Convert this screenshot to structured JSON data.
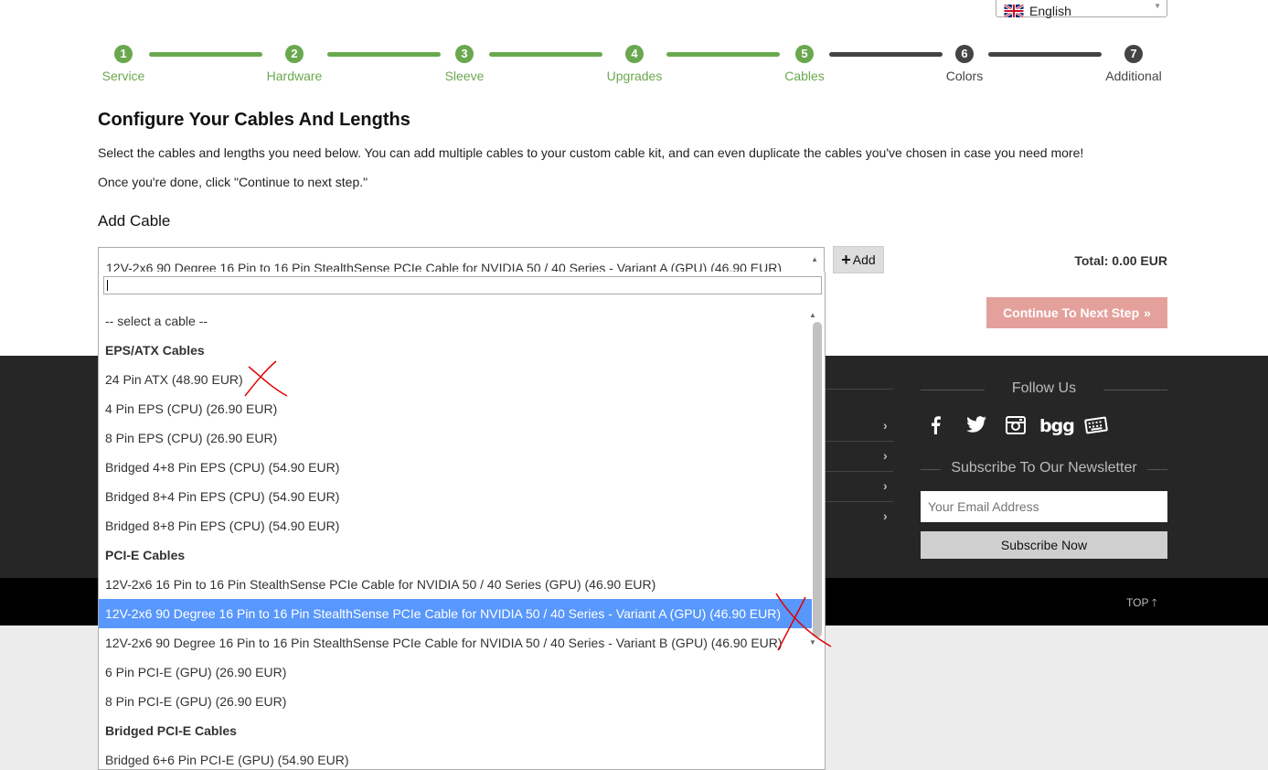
{
  "language": {
    "label": "English"
  },
  "steps": [
    {
      "num": "1",
      "label": "Service",
      "state": "done"
    },
    {
      "num": "2",
      "label": "Hardware",
      "state": "done"
    },
    {
      "num": "3",
      "label": "Sleeve",
      "state": "done"
    },
    {
      "num": "4",
      "label": "Upgrades",
      "state": "done"
    },
    {
      "num": "5",
      "label": "Cables",
      "state": "done"
    },
    {
      "num": "6",
      "label": "Colors",
      "state": "todo"
    },
    {
      "num": "7",
      "label": "Additional",
      "state": "todo"
    }
  ],
  "main": {
    "title": "Configure Your Cables And Lengths",
    "intro": "Select the cables and lengths you need below. You can add multiple cables to your custom cable kit, and can even duplicate the cables you've chosen in case you need more!",
    "instruction": "Once you're done, click \"Continue to next step.\"",
    "add_cable_heading": "Add Cable",
    "selected_cable": "12V-2x6 90 Degree 16 Pin to 16 Pin StealthSense PCIe Cable for NVIDIA 50 / 40 Series - Variant A (GPU) (46.90 EUR)",
    "add_label": "Add",
    "total": "Total: 0.00 EUR",
    "continue_label": "Continue To Next Step"
  },
  "dropdown": {
    "items": [
      {
        "label": "-- select a cable --",
        "kind": "option"
      },
      {
        "label": "EPS/ATX Cables",
        "kind": "group"
      },
      {
        "label": "24 Pin ATX (48.90 EUR)",
        "kind": "option"
      },
      {
        "label": "4 Pin EPS (CPU) (26.90 EUR)",
        "kind": "option"
      },
      {
        "label": "8 Pin EPS (CPU) (26.90 EUR)",
        "kind": "option"
      },
      {
        "label": "Bridged 4+8 Pin EPS (CPU) (54.90 EUR)",
        "kind": "option"
      },
      {
        "label": "Bridged 8+4 Pin EPS (CPU) (54.90 EUR)",
        "kind": "option"
      },
      {
        "label": "Bridged 8+8 Pin EPS (CPU) (54.90 EUR)",
        "kind": "option"
      },
      {
        "label": "PCI-E Cables",
        "kind": "group"
      },
      {
        "label": "12V-2x6 16 Pin to 16 Pin StealthSense PCIe Cable for NVIDIA 50 / 40 Series (GPU) (46.90 EUR)",
        "kind": "option"
      },
      {
        "label": "12V-2x6 90 Degree 16 Pin to 16 Pin StealthSense PCIe Cable for NVIDIA 50 / 40 Series - Variant A (GPU) (46.90 EUR)",
        "kind": "highlighted"
      },
      {
        "label": "12V-2x6 90 Degree 16 Pin to 16 Pin StealthSense PCIe Cable for NVIDIA 50 / 40 Series - Variant B (GPU) (46.90 EUR)",
        "kind": "option"
      },
      {
        "label": "6 Pin PCI-E (GPU) (26.90 EUR)",
        "kind": "option"
      },
      {
        "label": "8 Pin PCI-E (GPU) (26.90 EUR)",
        "kind": "option"
      },
      {
        "label": "Bridged PCI-E Cables",
        "kind": "group"
      },
      {
        "label": "Bridged 6+6 Pin PCI-E (GPU) (54.90 EUR)",
        "kind": "option"
      }
    ]
  },
  "footer": {
    "follow_heading": "Follow Us",
    "social": [
      "facebook-icon",
      "twitter-icon",
      "instagram-icon",
      "bgg-icon",
      "keyboard-icon"
    ],
    "bgg_text": "bgg",
    "newsletter_heading": "Subscribe To Our Newsletter",
    "email_placeholder": "Your Email Address",
    "subscribe_label": "Subscribe Now",
    "top_label": "TOP"
  },
  "colors": {
    "accent_green": "#6aa84f",
    "highlight": "#5897fb",
    "continue_bg": "#e4a09b",
    "annotation": "#e00000"
  }
}
